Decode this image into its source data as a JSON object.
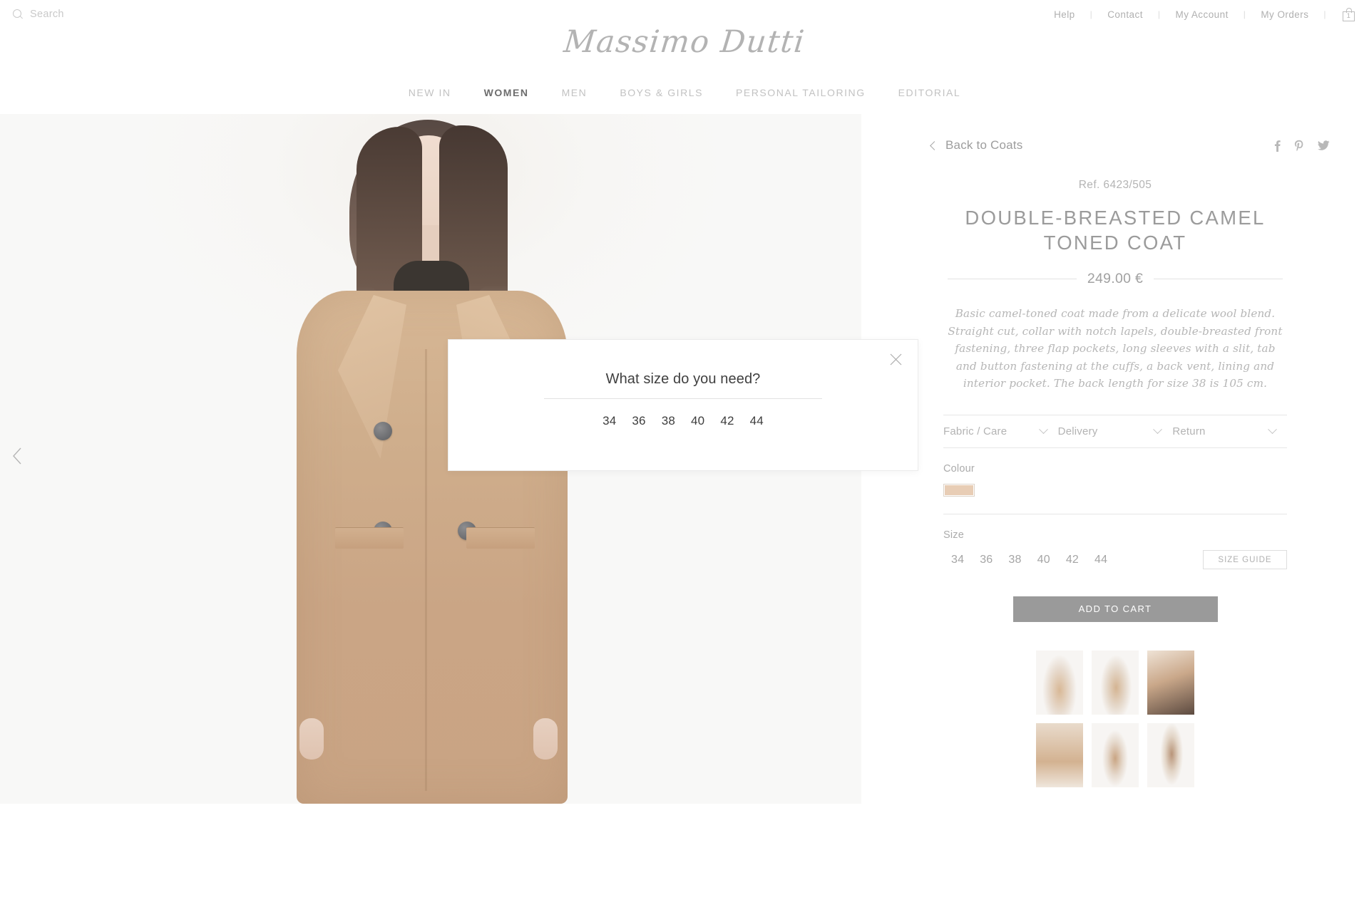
{
  "utility_bar": {
    "search": {
      "icon": "search-icon",
      "placeholder": "Search",
      "value": ""
    },
    "links": [
      {
        "label": "Help"
      },
      {
        "label": "Contact"
      },
      {
        "label": "My Account"
      },
      {
        "label": "My Orders"
      }
    ],
    "separator": "|",
    "cart": {
      "icon": "shopping-bag-icon",
      "count": "1"
    }
  },
  "brand": {
    "name": "Massimo Dutti"
  },
  "main_nav": {
    "items": [
      {
        "label": "NEW IN",
        "active": false
      },
      {
        "label": "WOMEN",
        "active": true
      },
      {
        "label": "MEN",
        "active": false
      },
      {
        "label": "BOYS & GIRLS",
        "active": false
      },
      {
        "label": "PERSONAL TAILORING",
        "active": false
      },
      {
        "label": "EDITORIAL",
        "active": false
      }
    ]
  },
  "gallery": {
    "prev_icon": "chevron-left-icon",
    "next_icon": "chevron-right-icon",
    "image_alt": "Model wearing camel double-breasted coat"
  },
  "product": {
    "back_link": {
      "label": "Back to Coats",
      "icon": "chevron-left-icon"
    },
    "social": [
      {
        "name": "facebook-icon"
      },
      {
        "name": "pinterest-icon"
      },
      {
        "name": "twitter-icon"
      }
    ],
    "reference": "Ref. 6423/505",
    "title": "DOUBLE-BREASTED CAMEL TONED COAT",
    "price": "249.00 €",
    "description": "Basic camel-toned coat made from a delicate wool blend. Straight cut, collar with notch lapels, double-breasted front fastening, three flap pockets, long sleeves with a slit, tab and button fastening at the cuffs, a back vent, lining and interior pocket. The back length for size 38 is 105 cm.",
    "accordions": [
      {
        "label": "Fabric / Care",
        "icon": "chevron-down-icon"
      },
      {
        "label": "Delivery",
        "icon": "chevron-down-icon"
      },
      {
        "label": "Return",
        "icon": "chevron-down-icon"
      }
    ],
    "colour": {
      "label": "Colour",
      "swatches": [
        {
          "name": "camel",
          "hex": "#e8cdb5"
        }
      ]
    },
    "size": {
      "label": "Size",
      "options": [
        "34",
        "36",
        "38",
        "40",
        "42",
        "44"
      ],
      "guide_label": "SIZE GUIDE"
    },
    "add_to_cart_label": "ADD TO CART",
    "add_to_cart_color": "#9a9a9a",
    "thumbnails": [
      {
        "alt": "Front full length"
      },
      {
        "alt": "Three quarter view"
      },
      {
        "alt": "Close up collar"
      },
      {
        "alt": "Detail pocket"
      },
      {
        "alt": "Back view"
      },
      {
        "alt": "Side view"
      }
    ]
  },
  "modal": {
    "title": "What size do you need?",
    "close_icon": "close-icon",
    "sizes": [
      "34",
      "36",
      "38",
      "40",
      "42",
      "44"
    ]
  }
}
